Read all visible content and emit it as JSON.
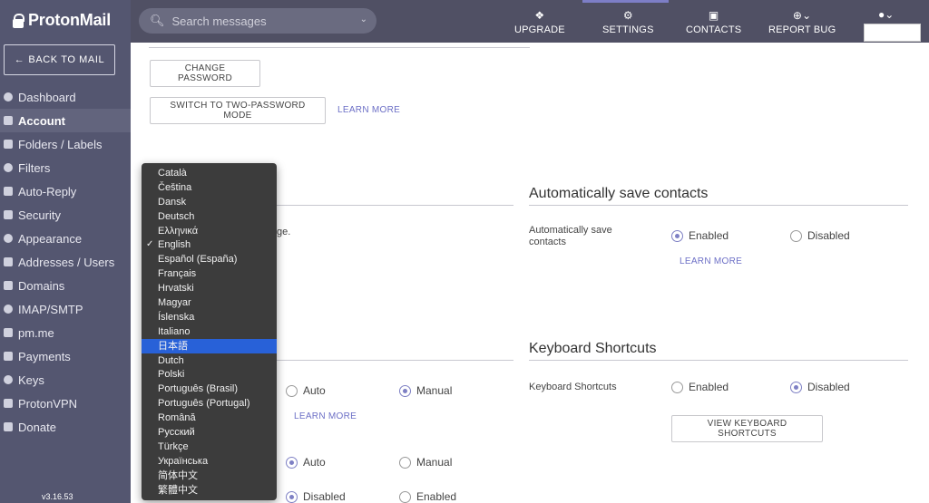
{
  "sidebar": {
    "logo": "ProtonMail",
    "back_label": "BACK TO MAIL",
    "items": [
      {
        "label": "Dashboard",
        "icon": "dashboard-icon"
      },
      {
        "label": "Account",
        "icon": "user-icon",
        "active": true
      },
      {
        "label": "Folders / Labels",
        "icon": "folder-icon"
      },
      {
        "label": "Filters",
        "icon": "filter-icon"
      },
      {
        "label": "Auto-Reply",
        "icon": "reply-icon"
      },
      {
        "label": "Security",
        "icon": "shield-icon"
      },
      {
        "label": "Appearance",
        "icon": "brush-icon"
      },
      {
        "label": "Addresses / Users",
        "icon": "users-icon"
      },
      {
        "label": "Domains",
        "icon": "globe-icon"
      },
      {
        "label": "IMAP/SMTP",
        "icon": "monitor-icon"
      },
      {
        "label": "pm.me",
        "icon": "at-icon"
      },
      {
        "label": "Payments",
        "icon": "card-icon"
      },
      {
        "label": "Keys",
        "icon": "key-icon"
      },
      {
        "label": "ProtonVPN",
        "icon": "vpn-icon"
      },
      {
        "label": "Donate",
        "icon": "heart-icon"
      }
    ],
    "version": "v3.16.53"
  },
  "topbar": {
    "search_placeholder": "Search messages",
    "nav": [
      {
        "label": "UPGRADE",
        "icon": "upgrade-icon"
      },
      {
        "label": "SETTINGS",
        "icon": "settings-icon"
      },
      {
        "label": "CONTACTS",
        "icon": "contacts-icon"
      },
      {
        "label": "REPORT BUG",
        "icon": "bug-icon"
      }
    ]
  },
  "main": {
    "change_password": "CHANGE PASSWORD",
    "two_password": "SWITCH TO TWO-PASSWORD MODE",
    "learn_more": "LEARN MORE",
    "language_partial": "ge.",
    "auto_save": {
      "title": "Automatically save contacts",
      "label": "Automatically save contacts",
      "enabled": "Enabled",
      "disabled": "Disabled",
      "learn_more": "LEARN MORE"
    },
    "keyboard": {
      "title": "Keyboard Shortcuts",
      "label": "Keyboard Shortcuts",
      "enabled": "Enabled",
      "disabled": "Disabled",
      "view_button": "VIEW KEYBOARD SHORTCUTS"
    },
    "row1": {
      "auto": "Auto",
      "manual": "Manual",
      "learn_more": "LEARN MORE"
    },
    "row2": {
      "auto": "Auto",
      "manual": "Manual"
    },
    "row3": {
      "disabled": "Disabled",
      "enabled": "Enabled"
    }
  },
  "language_dropdown": {
    "selected": "日本語",
    "checked": "English",
    "options": [
      "Català",
      "Čeština",
      "Dansk",
      "Deutsch",
      "Ελληνικά",
      "English",
      "Español (España)",
      "Français",
      "Hrvatski",
      "Magyar",
      "Íslenska",
      "Italiano",
      "日本語",
      "Dutch",
      "Polski",
      "Português (Brasil)",
      "Português (Portugal)",
      "Română",
      "Русский",
      "Türkçe",
      "Українська",
      "简体中文",
      "繁體中文"
    ]
  },
  "colors": {
    "sidebar": "#545670",
    "topbar": "#505064",
    "accent": "#7e80c4",
    "link": "#6c6fc6",
    "dropdown_selected": "#2861d8"
  }
}
